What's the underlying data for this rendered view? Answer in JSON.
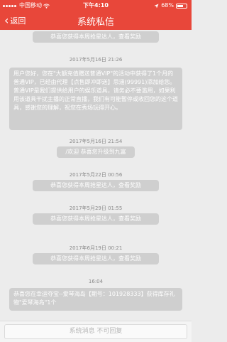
{
  "status_bar": {
    "carrier": "中国移动",
    "wifi_icon": "wifi-icon",
    "time": "下午4:10",
    "battery_percent": "68%",
    "battery_level": 0.68,
    "location_icon": "location-arrow-icon"
  },
  "nav": {
    "back_label": "返回",
    "title": "系统私信"
  },
  "messages": [
    {
      "type": "bubble",
      "text": "恭喜您获得本周抢星达人，查看奖励"
    },
    {
      "type": "time",
      "text": "2017年5月16日 21:26"
    },
    {
      "type": "bubble",
      "text": "用户您好，您在\"大额充值赠送普通VIP\"的活动中获得了1个月的普通VIP，已经由代理【点售即冲即送】思涵(99991)添加给您。普通VIP是我们提供给用户的娱乐道具，请务必不要滥用，如果利用该道具干扰主播的正常直播，我们有可能暂停或收回您的这个道具，感谢您的理解，祝您在秀场玩得开心。"
    },
    {
      "type": "time",
      "text": "2017年5月16日 21:54"
    },
    {
      "type": "bubble",
      "text": "/欢迎  恭喜您升级到九富"
    },
    {
      "type": "time",
      "text": "2017年5月22日 00:56"
    },
    {
      "type": "bubble",
      "text": "恭喜您获得本周抢星达人，查看奖励"
    },
    {
      "type": "time",
      "text": "2017年5月29日 01:55"
    },
    {
      "type": "bubble",
      "text": "恭喜您获得本周抢星达人，查看奖励"
    },
    {
      "type": "time",
      "text": "2017年6月19日 00:21"
    },
    {
      "type": "bubble",
      "text": "恭喜您获得本周抢星达人，查看奖励"
    },
    {
      "type": "time",
      "text": "16:04"
    },
    {
      "type": "bubble",
      "text": "恭喜您在幸运夺宝--爱琴海岛【期号：101928333】获得库存礼物\"爱琴海岛\"1个"
    }
  ],
  "footer": {
    "placeholder": "系统消息 不可回复"
  }
}
